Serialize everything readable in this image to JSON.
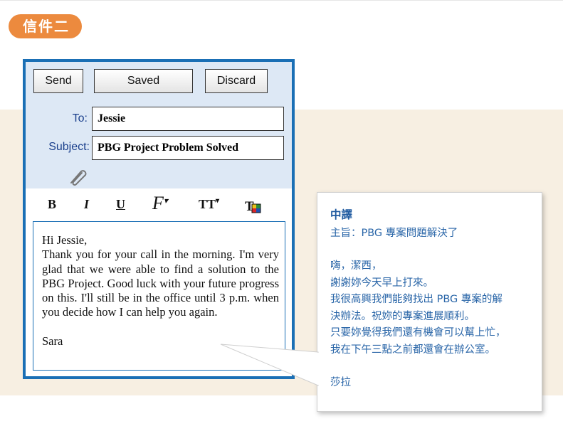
{
  "tag": {
    "label": "信件二"
  },
  "toolbar": {
    "send_label": "Send",
    "saved_label": "Saved",
    "discard_label": "Discard"
  },
  "fields": {
    "to_label": "To:",
    "to_value": "Jessie",
    "subject_label": "Subject:",
    "subject_value": "PBG Project Problem Solved"
  },
  "format": {
    "bold": "B",
    "italic": "I",
    "underline": "U",
    "font": "F",
    "size": "TT"
  },
  "email_body": {
    "greeting": "Hi Jessie,",
    "paragraph": "Thank you for your call in the morning. I'm very glad that we were able to find a solution to the PBG Project. Good luck with your future progress on this. I'll still be in the office until 3 p.m. when you decide how I can help you again.",
    "signature": "Sara"
  },
  "translation": {
    "heading": "中譯",
    "subject": "主旨：PBG 專案問題解決了",
    "greeting": "嗨，潔西，",
    "lines": [
      "謝謝妳今天早上打來。",
      "我很高興我們能夠找出 PBG 專案的解",
      "決辦法。祝妳的專案進展順利。",
      "只要妳覺得我們還有機會可以幫上忙，",
      "我在下午三點之前都還會在辦公室。"
    ],
    "signature": "莎拉"
  },
  "colors": {
    "accent_orange": "#ec8a3e",
    "frame_blue": "#1a6fb5",
    "panel_blue": "#dde8f5",
    "band_beige": "#f7efe2",
    "translation_text": "#2a66a8"
  }
}
